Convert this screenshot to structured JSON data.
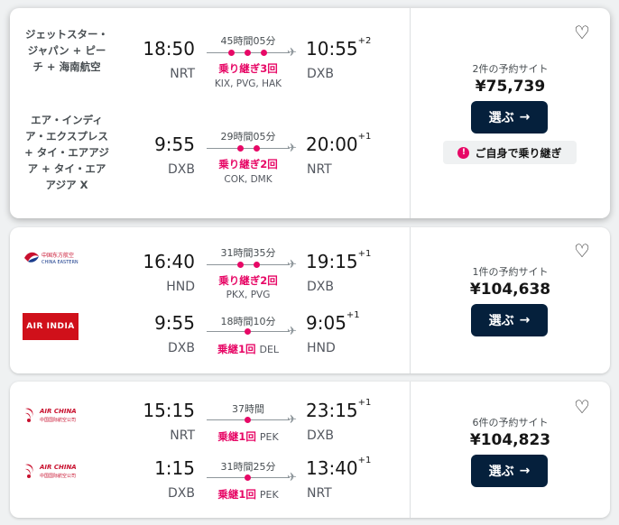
{
  "results": [
    {
      "legs": [
        {
          "airline": "ジェットスター・ジャパン + ピーチ + 海南航空",
          "dep_time": "18:50",
          "dep_code": "NRT",
          "duration": "45時間05分",
          "stops_label": "乗り継ぎ3回",
          "via": "KIX, PVG, HAK",
          "arr_time": "10:55",
          "arr_plus": "+2",
          "arr_code": "DXB"
        },
        {
          "airline": "エア・インディア・エクスプレス + タイ・エアアジア + タイ・エアアジア X",
          "dep_time": "9:55",
          "dep_code": "DXB",
          "duration": "29時間05分",
          "stops_label": "乗り継ぎ2回",
          "via": "COK, DMK",
          "arr_time": "20:00",
          "arr_plus": "+1",
          "arr_code": "NRT"
        }
      ],
      "sites": "2件の予約サイト",
      "price": "¥75,739",
      "select_label": "選ぶ",
      "badge": "ご自身で乗り継ぎ"
    },
    {
      "legs": [
        {
          "airline_logo": "CHINA EASTERN",
          "airline_logo_cn": "中国东方航空",
          "dep_time": "16:40",
          "dep_code": "HND",
          "duration": "31時間35分",
          "stops_label": "乗り継ぎ2回",
          "via": "PKX, PVG",
          "arr_time": "19:15",
          "arr_plus": "+1",
          "arr_code": "DXB"
        },
        {
          "airline_logo": "AIR INDIA",
          "dep_time": "9:55",
          "dep_code": "DXB",
          "duration": "18時間10分",
          "stops_label": "乗継1回",
          "via": "DEL",
          "arr_time": "9:05",
          "arr_plus": "+1",
          "arr_code": "HND"
        }
      ],
      "sites": "1件の予約サイト",
      "price": "¥104,638",
      "select_label": "選ぶ"
    },
    {
      "legs": [
        {
          "airline_logo": "AIR CHINA",
          "airline_logo_cn": "中国国际航空公司",
          "dep_time": "15:15",
          "dep_code": "NRT",
          "duration": "37時間",
          "stops_label": "乗継1回",
          "via": "PEK",
          "arr_time": "23:15",
          "arr_plus": "+1",
          "arr_code": "DXB"
        },
        {
          "airline_logo": "AIR CHINA",
          "airline_logo_cn": "中国国际航空公司",
          "dep_time": "1:15",
          "dep_code": "DXB",
          "duration": "31時間25分",
          "stops_label": "乗継1回",
          "via": "PEK",
          "arr_time": "13:40",
          "arr_plus": "+1",
          "arr_code": "NRT"
        }
      ],
      "sites": "6件の予約サイト",
      "price": "¥104,823",
      "select_label": "選ぶ"
    }
  ],
  "icons": {
    "heart": "heart-outline-icon",
    "arrow": "arrow-right-icon",
    "plane": "plane-icon",
    "alert": "alert-icon"
  },
  "colors": {
    "accent": "#e70866",
    "button": "#05203c",
    "background": "#eff1f2"
  }
}
